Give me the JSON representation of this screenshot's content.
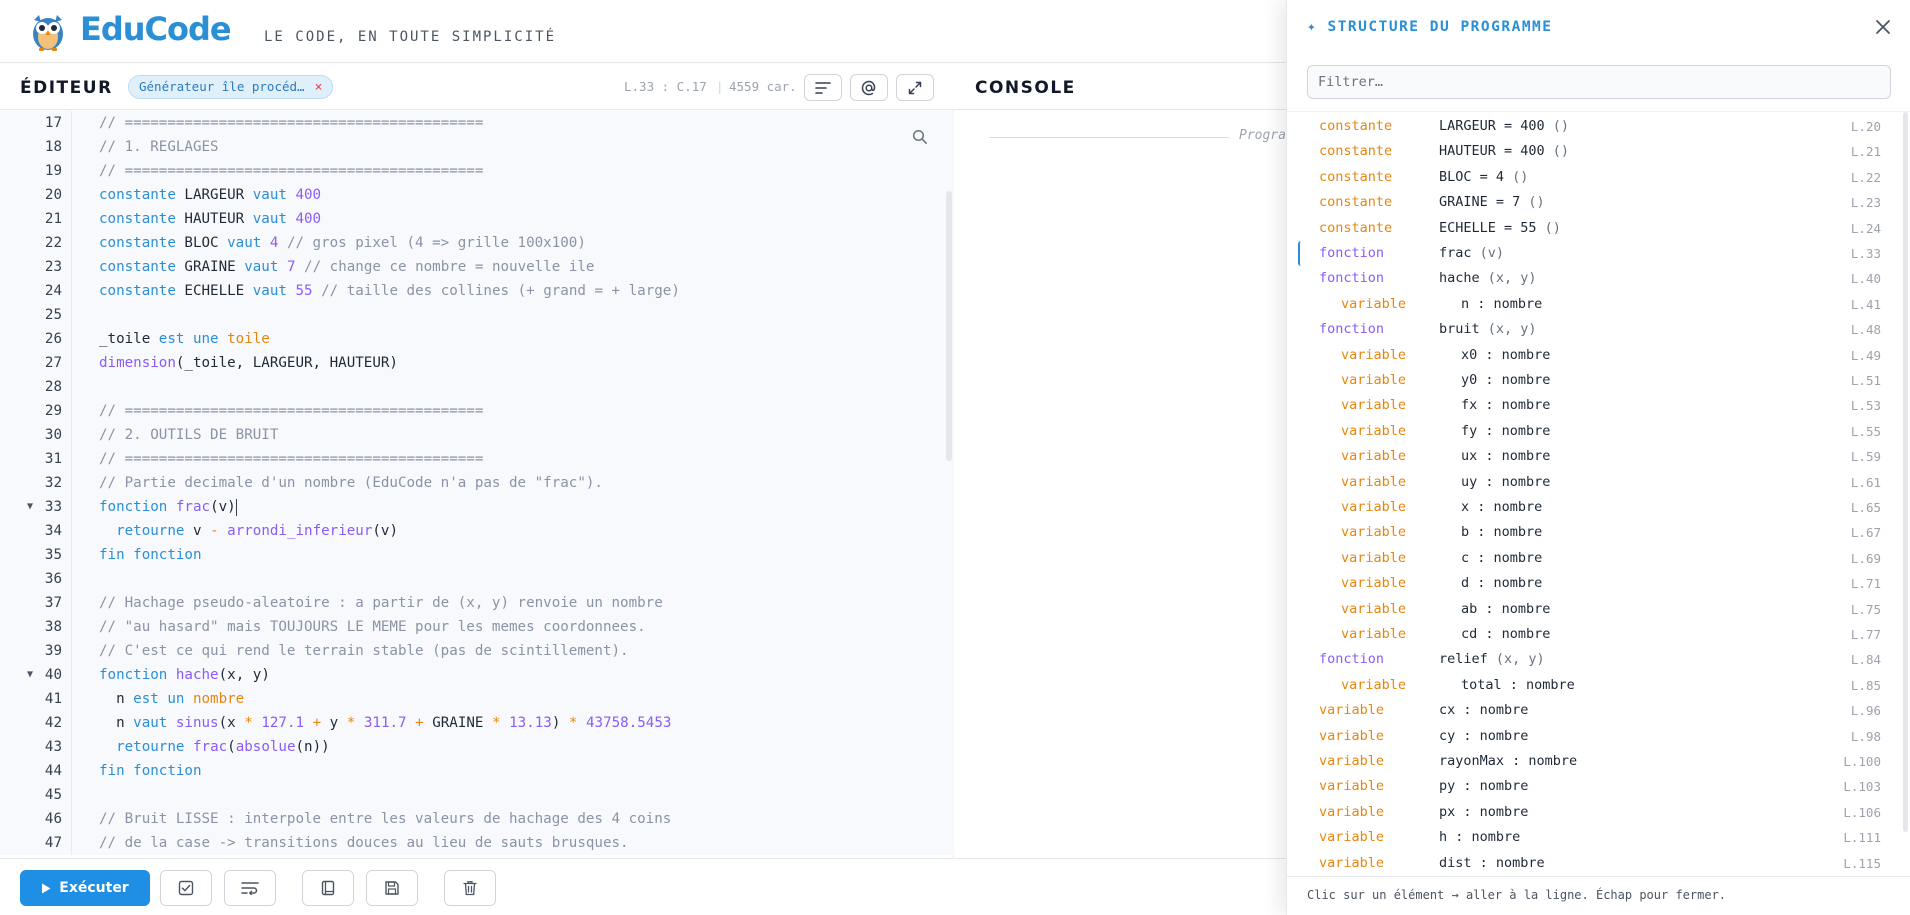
{
  "app": {
    "name": "EduCode",
    "tagline": "LE CODE, EN TOUTE SIMPLICITÉ"
  },
  "editor": {
    "title": "ÉDITEUR",
    "file_name": "Générateur île procéd…",
    "cursor": "L.33 : C.17",
    "char_count": "4559 car.",
    "separator": "|",
    "lines": [
      {
        "n": "17",
        "tokens": [
          [
            "c-com",
            "// =========================================="
          ]
        ]
      },
      {
        "n": "18",
        "tokens": [
          [
            "c-com",
            "// 1. REGLAGES"
          ]
        ]
      },
      {
        "n": "19",
        "tokens": [
          [
            "c-com",
            "// =========================================="
          ]
        ]
      },
      {
        "n": "20",
        "tokens": [
          [
            "c-kw",
            "constante"
          ],
          [
            "",
            " LARGEUR "
          ],
          [
            "c-kw",
            "vaut"
          ],
          [
            "",
            " "
          ],
          [
            "c-num",
            "400"
          ]
        ]
      },
      {
        "n": "21",
        "tokens": [
          [
            "c-kw",
            "constante"
          ],
          [
            "",
            " HAUTEUR "
          ],
          [
            "c-kw",
            "vaut"
          ],
          [
            "",
            " "
          ],
          [
            "c-num",
            "400"
          ]
        ]
      },
      {
        "n": "22",
        "tokens": [
          [
            "c-kw",
            "constante"
          ],
          [
            "",
            " BLOC "
          ],
          [
            "c-kw",
            "vaut"
          ],
          [
            "",
            " "
          ],
          [
            "c-num",
            "4"
          ],
          [
            "",
            " "
          ],
          [
            "c-com",
            "// gros pixel (4 => grille 100x100)"
          ]
        ]
      },
      {
        "n": "23",
        "tokens": [
          [
            "c-kw",
            "constante"
          ],
          [
            "",
            " GRAINE "
          ],
          [
            "c-kw",
            "vaut"
          ],
          [
            "",
            " "
          ],
          [
            "c-num",
            "7"
          ],
          [
            "",
            " "
          ],
          [
            "c-com",
            "// change ce nombre = nouvelle ile"
          ]
        ]
      },
      {
        "n": "24",
        "tokens": [
          [
            "c-kw",
            "constante"
          ],
          [
            "",
            " ECHELLE "
          ],
          [
            "c-kw",
            "vaut"
          ],
          [
            "",
            " "
          ],
          [
            "c-num",
            "55"
          ],
          [
            "",
            " "
          ],
          [
            "c-com",
            "// taille des collines (+ grand = + large)"
          ]
        ]
      },
      {
        "n": "25",
        "tokens": []
      },
      {
        "n": "26",
        "tokens": [
          [
            "",
            "_toile "
          ],
          [
            "c-kw",
            "est une"
          ],
          [
            "",
            " "
          ],
          [
            "c-type",
            "toile"
          ]
        ]
      },
      {
        "n": "27",
        "tokens": [
          [
            "c-fn",
            "dimension"
          ],
          [
            "",
            "(_toile, LARGEUR, HAUTEUR)"
          ]
        ]
      },
      {
        "n": "28",
        "tokens": []
      },
      {
        "n": "29",
        "tokens": [
          [
            "c-com",
            "// =========================================="
          ]
        ]
      },
      {
        "n": "30",
        "tokens": [
          [
            "c-com",
            "// 2. OUTILS DE BRUIT"
          ]
        ]
      },
      {
        "n": "31",
        "tokens": [
          [
            "c-com",
            "// =========================================="
          ]
        ]
      },
      {
        "n": "32",
        "tokens": [
          [
            "c-com",
            "// Partie decimale d'un nombre (EduCode n'a pas de \"frac\")."
          ]
        ]
      },
      {
        "n": "33",
        "fold": true,
        "caret": true,
        "tokens": [
          [
            "c-kw",
            "fonction"
          ],
          [
            "",
            " "
          ],
          [
            "c-fn",
            "frac"
          ],
          [
            "",
            "(v)"
          ]
        ]
      },
      {
        "n": "34",
        "tokens": [
          [
            "",
            "  "
          ],
          [
            "c-kw",
            "retourne"
          ],
          [
            "",
            " v "
          ],
          [
            "c-op",
            "-"
          ],
          [
            "",
            " "
          ],
          [
            "c-fn",
            "arrondi_inferieur"
          ],
          [
            "",
            "(v)"
          ]
        ]
      },
      {
        "n": "35",
        "tokens": [
          [
            "c-kw",
            "fin fonction"
          ]
        ]
      },
      {
        "n": "36",
        "tokens": []
      },
      {
        "n": "37",
        "tokens": [
          [
            "c-com",
            "// Hachage pseudo-aleatoire : a partir de (x, y) renvoie un nombre"
          ]
        ]
      },
      {
        "n": "38",
        "tokens": [
          [
            "c-com",
            "// \"au hasard\" mais TOUJOURS LE MEME pour les memes coordonnees."
          ]
        ]
      },
      {
        "n": "39",
        "tokens": [
          [
            "c-com",
            "// C'est ce qui rend le terrain stable (pas de scintillement)."
          ]
        ]
      },
      {
        "n": "40",
        "fold": true,
        "tokens": [
          [
            "c-kw",
            "fonction"
          ],
          [
            "",
            " "
          ],
          [
            "c-fn",
            "hache"
          ],
          [
            "",
            "(x, y)"
          ]
        ]
      },
      {
        "n": "41",
        "tokens": [
          [
            "",
            "  n "
          ],
          [
            "c-kw",
            "est un"
          ],
          [
            "",
            " "
          ],
          [
            "c-type",
            "nombre"
          ]
        ]
      },
      {
        "n": "42",
        "tokens": [
          [
            "",
            "  n "
          ],
          [
            "c-kw",
            "vaut"
          ],
          [
            "",
            " "
          ],
          [
            "c-fn",
            "sinus"
          ],
          [
            "",
            "(x "
          ],
          [
            "c-op",
            "*"
          ],
          [
            "",
            " "
          ],
          [
            "c-num",
            "127.1"
          ],
          [
            "",
            " "
          ],
          [
            "c-op",
            "+"
          ],
          [
            "",
            " y "
          ],
          [
            "c-op",
            "*"
          ],
          [
            "",
            " "
          ],
          [
            "c-num",
            "311.7"
          ],
          [
            "",
            " "
          ],
          [
            "c-op",
            "+"
          ],
          [
            "",
            " GRAINE "
          ],
          [
            "c-op",
            "*"
          ],
          [
            "",
            " "
          ],
          [
            "c-num",
            "13.13"
          ],
          [
            "",
            ") "
          ],
          [
            "c-op",
            "*"
          ],
          [
            "",
            " "
          ],
          [
            "c-num",
            "43758.5453"
          ]
        ]
      },
      {
        "n": "43",
        "tokens": [
          [
            "",
            "  "
          ],
          [
            "c-kw",
            "retourne"
          ],
          [
            "",
            " "
          ],
          [
            "c-fn",
            "frac"
          ],
          [
            "",
            "("
          ],
          [
            "c-fn",
            "absolue"
          ],
          [
            "",
            "(n))"
          ]
        ]
      },
      {
        "n": "44",
        "tokens": [
          [
            "c-kw",
            "fin fonction"
          ]
        ]
      },
      {
        "n": "45",
        "tokens": []
      },
      {
        "n": "46",
        "tokens": [
          [
            "c-com",
            "// Bruit LISSE : interpole entre les valeurs de hachage des 4 coins"
          ]
        ]
      },
      {
        "n": "47",
        "tokens": [
          [
            "c-com",
            "// de la case -> transitions douces au lieu de sauts brusques."
          ]
        ]
      }
    ]
  },
  "toolbar": {
    "run_label": "Exécuter"
  },
  "console": {
    "title": "CONSOLE",
    "hint": "Progra"
  },
  "structure": {
    "title": "✦ STRUCTURE DU PROGRAMME",
    "filter_placeholder": "Filtrer…",
    "footer": "Clic sur un élément → aller à la ligne. Échap pour fermer.",
    "items": [
      {
        "kind": "constante",
        "indent": 0,
        "name": "LARGEUR = 400",
        "args": " ()",
        "line": "L.20"
      },
      {
        "kind": "constante",
        "indent": 0,
        "name": "HAUTEUR = 400",
        "args": " ()",
        "line": "L.21"
      },
      {
        "kind": "constante",
        "indent": 0,
        "name": "BLOC = 4",
        "args": " ()",
        "line": "L.22"
      },
      {
        "kind": "constante",
        "indent": 0,
        "name": "GRAINE = 7",
        "args": " ()",
        "line": "L.23"
      },
      {
        "kind": "constante",
        "indent": 0,
        "name": "ECHELLE = 55",
        "args": " ()",
        "line": "L.24"
      },
      {
        "kind": "fonction",
        "indent": 0,
        "name": "frac",
        "args": " (v)",
        "line": "L.33",
        "active": true
      },
      {
        "kind": "fonction",
        "indent": 0,
        "name": "hache",
        "args": " (x, y)",
        "line": "L.40"
      },
      {
        "kind": "variable",
        "indent": 1,
        "name": "n : nombre",
        "args": "",
        "line": "L.41"
      },
      {
        "kind": "fonction",
        "indent": 0,
        "name": "bruit",
        "args": " (x, y)",
        "line": "L.48"
      },
      {
        "kind": "variable",
        "indent": 1,
        "name": "x0 : nombre",
        "args": "",
        "line": "L.49"
      },
      {
        "kind": "variable",
        "indent": 1,
        "name": "y0 : nombre",
        "args": "",
        "line": "L.51"
      },
      {
        "kind": "variable",
        "indent": 1,
        "name": "fx : nombre",
        "args": "",
        "line": "L.53"
      },
      {
        "kind": "variable",
        "indent": 1,
        "name": "fy : nombre",
        "args": "",
        "line": "L.55"
      },
      {
        "kind": "variable",
        "indent": 1,
        "name": "ux : nombre",
        "args": "",
        "line": "L.59"
      },
      {
        "kind": "variable",
        "indent": 1,
        "name": "uy : nombre",
        "args": "",
        "line": "L.61"
      },
      {
        "kind": "variable",
        "indent": 1,
        "name": "x : nombre",
        "args": "",
        "line": "L.65"
      },
      {
        "kind": "variable",
        "indent": 1,
        "name": "b : nombre",
        "args": "",
        "line": "L.67"
      },
      {
        "kind": "variable",
        "indent": 1,
        "name": "c : nombre",
        "args": "",
        "line": "L.69"
      },
      {
        "kind": "variable",
        "indent": 1,
        "name": "d : nombre",
        "args": "",
        "line": "L.71"
      },
      {
        "kind": "variable",
        "indent": 1,
        "name": "ab : nombre",
        "args": "",
        "line": "L.75"
      },
      {
        "kind": "variable",
        "indent": 1,
        "name": "cd : nombre",
        "args": "",
        "line": "L.77"
      },
      {
        "kind": "fonction",
        "indent": 0,
        "name": "relief",
        "args": " (x, y)",
        "line": "L.84"
      },
      {
        "kind": "variable",
        "indent": 1,
        "name": "total : nombre",
        "args": "",
        "line": "L.85"
      },
      {
        "kind": "variable",
        "indent": 0,
        "name": "cx : nombre",
        "args": "",
        "line": "L.96"
      },
      {
        "kind": "variable",
        "indent": 0,
        "name": "cy : nombre",
        "args": "",
        "line": "L.98"
      },
      {
        "kind": "variable",
        "indent": 0,
        "name": "rayonMax : nombre",
        "args": "",
        "line": "L.100"
      },
      {
        "kind": "variable",
        "indent": 0,
        "name": "py : nombre",
        "args": "",
        "line": "L.103"
      },
      {
        "kind": "variable",
        "indent": 0,
        "name": "px : nombre",
        "args": "",
        "line": "L.106"
      },
      {
        "kind": "variable",
        "indent": 0,
        "name": "h : nombre",
        "args": "",
        "line": "L.111"
      },
      {
        "kind": "variable",
        "indent": 0,
        "name": "dist : nombre",
        "args": "",
        "line": "L.115"
      }
    ]
  },
  "colors": {
    "accent": "#1f8fe5",
    "keyword": "#2b8fd6",
    "function": "#8b5cf6",
    "type": "#e8860c",
    "comment": "#8a94a6"
  }
}
